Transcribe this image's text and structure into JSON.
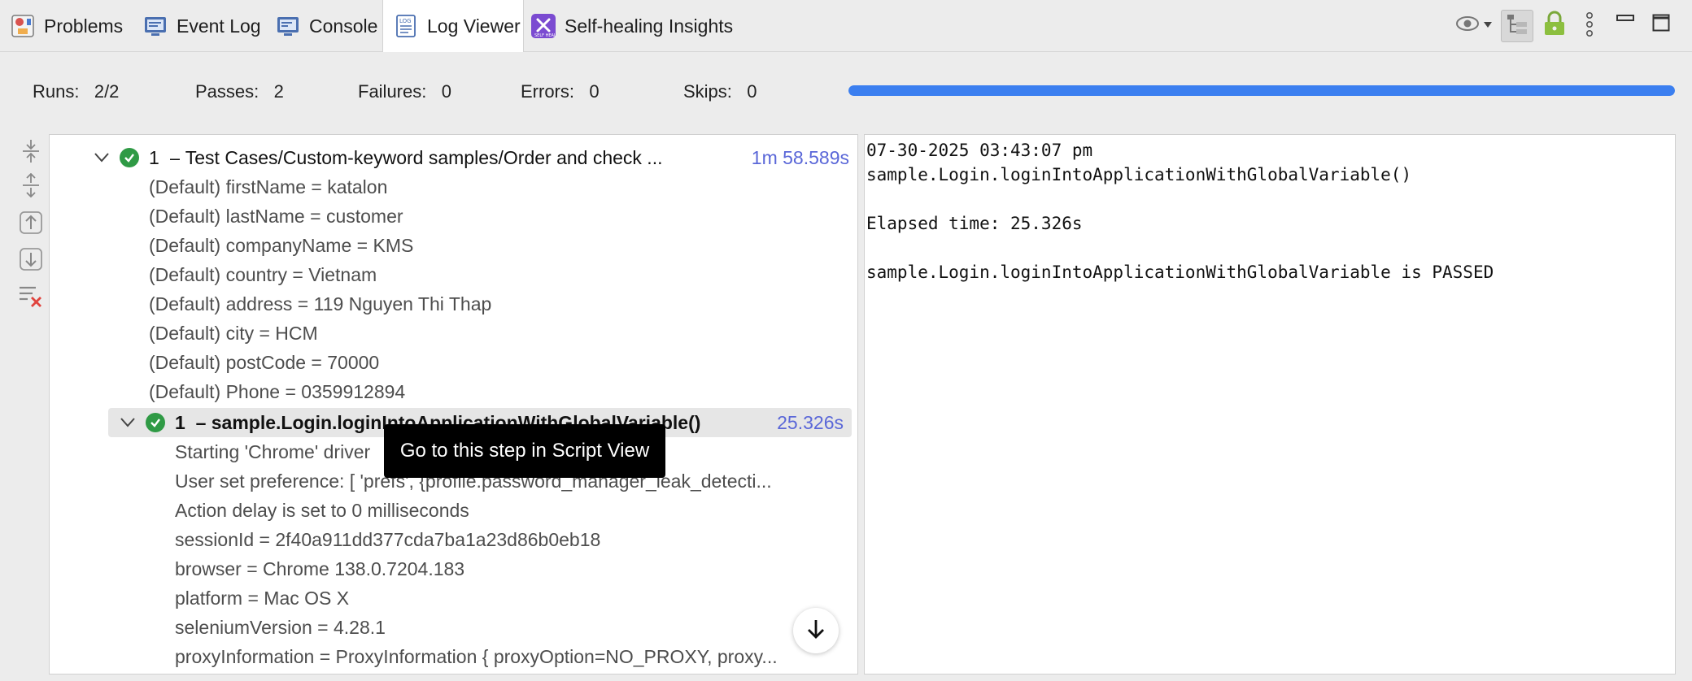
{
  "tabs": [
    {
      "label": "Problems",
      "icon": "problems-icon"
    },
    {
      "label": "Event Log",
      "icon": "event-log-icon"
    },
    {
      "label": "Console",
      "icon": "console-icon"
    },
    {
      "label": "Log Viewer",
      "icon": "log-viewer-icon",
      "active": true
    },
    {
      "label": "Self-healing Insights",
      "icon": "self-healing-icon"
    }
  ],
  "toolbar_icons": [
    "eye-icon",
    "tree-view-icon",
    "lock-icon",
    "more-icon",
    "minimize-icon",
    "maximize-icon"
  ],
  "stats": {
    "runs_label": "Runs:",
    "runs_value": "2/2",
    "passes_label": "Passes:",
    "passes_value": "2",
    "failures_label": "Failures:",
    "failures_value": "0",
    "errors_label": "Errors:",
    "errors_value": "0",
    "skips_label": "Skips:",
    "skips_value": "0",
    "progress": 1.0,
    "progress_color": "#3b7ff0"
  },
  "side_tools": [
    "collapse-all-icon",
    "expand-all-icon",
    "previous-failure-icon",
    "next-failure-icon",
    "clear-filter-icon"
  ],
  "tree": {
    "root": {
      "index": "1",
      "sep": "–",
      "label": "Test Cases/Custom-keyword samples/Order and check ...",
      "duration": "1m 58.589s"
    },
    "variables": [
      "(Default) firstName = katalon",
      "(Default) lastName = customer",
      "(Default) companyName = KMS",
      "(Default) country = Vietnam",
      "(Default) address = 119 Nguyen Thi Thap",
      "(Default) city = HCM",
      "(Default) postCode = 70000",
      "(Default) Phone = 0359912894"
    ],
    "step": {
      "index": "1",
      "sep": "–",
      "label": "sample.Login.loginIntoApplicationWithGlobalVariable()",
      "duration": "25.326s"
    },
    "step_logs": [
      "Starting 'Chrome' driver",
      "User set preference: [ 'prefs', {profile.password_manager_leak_detecti...",
      "Action delay is set to 0 milliseconds",
      "sessionId = 2f40a911dd377cda7ba1a23d86b0eb18",
      "browser = Chrome 138.0.7204.183",
      "platform = Mac OS X",
      "seleniumVersion = 4.28.1",
      "proxyInformation = ProxyInformation { proxyOption=NO_PROXY, proxy..."
    ]
  },
  "tooltip": "Go to this step in Script View",
  "detail": {
    "lines": [
      "07-30-2025 03:43:07 pm",
      "sample.Login.loginIntoApplicationWithGlobalVariable()",
      "",
      "Elapsed time: 25.326s",
      "",
      "sample.Login.loginIntoApplicationWithGlobalVariable is PASSED"
    ]
  },
  "colors": {
    "pass": "#2f9a45",
    "duration": "#5a67d8",
    "progress": "#3b7ff0"
  }
}
